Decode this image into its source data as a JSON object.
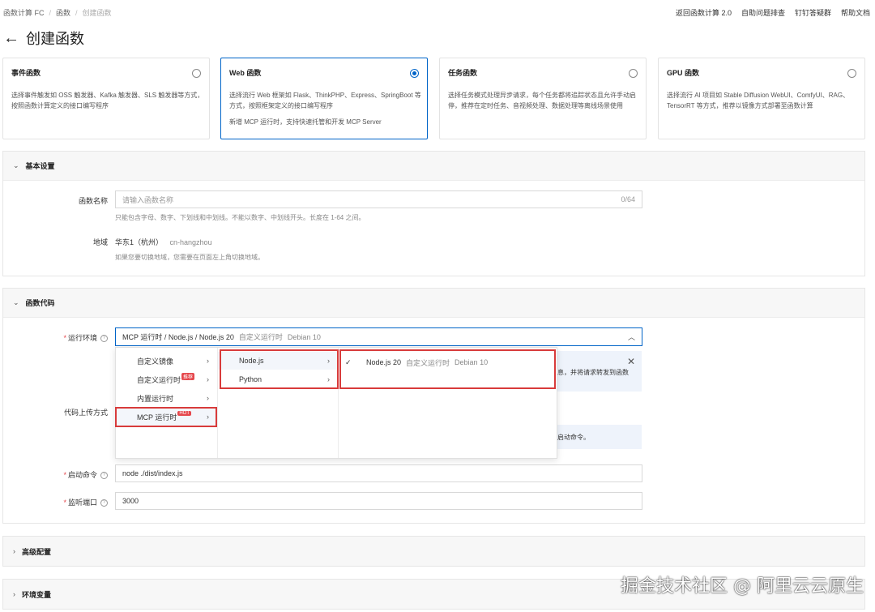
{
  "breadcrumb": [
    "函数计算 FC",
    "函数",
    "创建函数"
  ],
  "toplinks": [
    "返回函数计算 2.0",
    "自助问题排查",
    "钉钉答疑群",
    "帮助文档"
  ],
  "page_title": "创建函数",
  "cards": [
    {
      "title": "事件函数",
      "desc": "选择事件触发如 OSS 触发器、Kafka 触发器、SLS 触发器等方式，按照函数计算定义的接口编写程序",
      "extra": "",
      "selected": false
    },
    {
      "title": "Web 函数",
      "desc": "选择流行 Web 框架如 Flask、ThinkPHP、Express、SpringBoot 等方式，按照框架定义的接口编写程序",
      "extra": "新增 MCP 运行时，支持快速托管和开发 MCP Server",
      "selected": true
    },
    {
      "title": "任务函数",
      "desc": "选择任务模式处理异步请求，每个任务都将追踪状态且允许手动启停，推荐在定时任务、音视频处理、数据处理等离线场景使用",
      "extra": "",
      "selected": false
    },
    {
      "title": "GPU 函数",
      "desc": "选择流行 AI 项目如 Stable Diffusion WebUI、ComfyUI、RAG、TensorRT 等方式，推荐以镜像方式部署至函数计算",
      "extra": "",
      "selected": false
    }
  ],
  "basic": {
    "header": "基本设置",
    "name_label": "函数名称",
    "name_placeholder": "请输入函数名称",
    "name_count": "0/64",
    "name_hint": "只能包含字母、数字、下划线和中划线。不能以数字、中划线开头。长度在 1-64 之间。",
    "region_label": "地域",
    "region_value": "华东1（杭州）",
    "region_code": "cn-hangzhou",
    "region_hint": "如果您要切换地域，您需要在页面左上角切换地域。"
  },
  "code": {
    "header": "函数代码",
    "runtime_label": "运行环境",
    "runtime_value": "MCP 运行时 / Node.js / Node.js 20",
    "runtime_custom": "自定义运行时",
    "runtime_os": "Debian 10",
    "upload_label": "代码上传方式",
    "notice_text1": "息，并将请求转发到函数",
    "notice_text2": "启动命令。",
    "start_label": "启动命令",
    "start_value": "node ./dist/index.js",
    "port_label": "监听端口",
    "port_value": "3000"
  },
  "cascader": {
    "col1": [
      {
        "label": "自定义镜像",
        "tag": ""
      },
      {
        "label": "自定义运行时",
        "tag": "推荐"
      },
      {
        "label": "内置运行时",
        "tag": ""
      },
      {
        "label": "MCP 运行时",
        "tag": "HOT"
      }
    ],
    "col2": [
      "Node.js",
      "Python"
    ],
    "col3": {
      "label": "Node.js 20",
      "custom": "自定义运行时",
      "os": "Debian 10",
      "check": "✓"
    }
  },
  "advanced": {
    "header": "高级配置"
  },
  "env": {
    "header": "环境变量"
  },
  "watermark": "掘金技术社区 @ 阿里云云原生",
  "colors": {
    "accent": "#0064c8",
    "highlight": "#d83b3b",
    "required": "#e5484d"
  }
}
